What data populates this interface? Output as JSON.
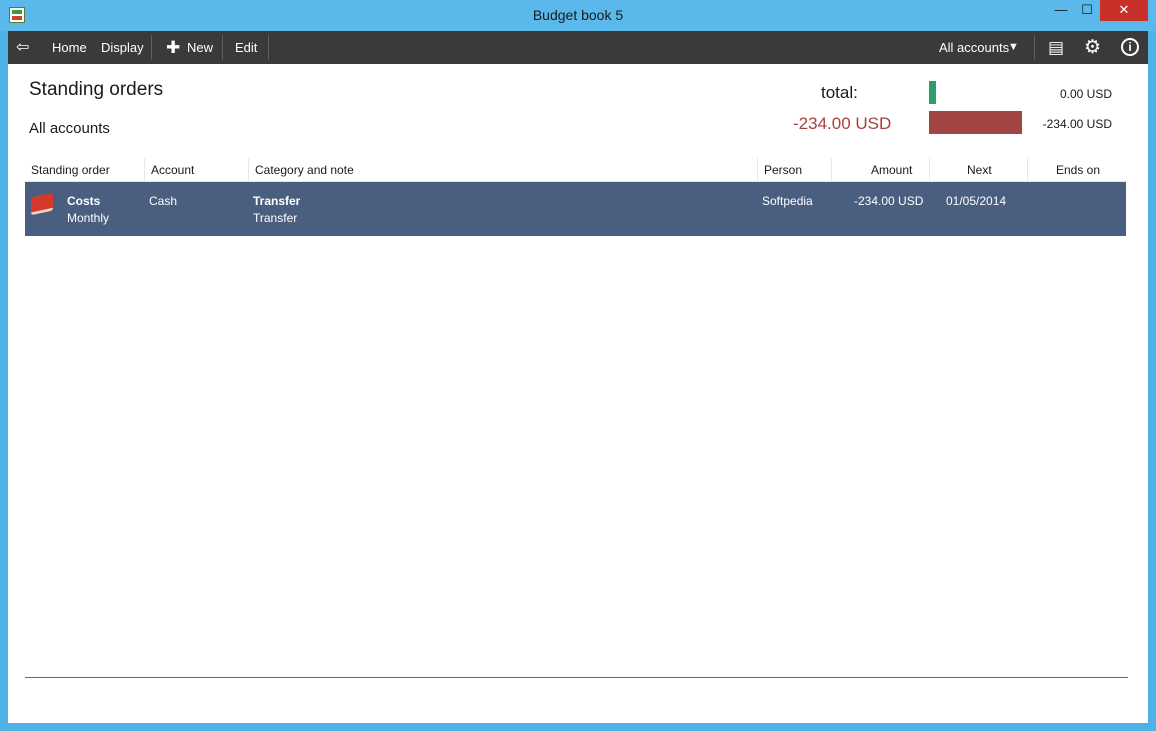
{
  "window": {
    "title": "Budget book 5",
    "minimize": "—",
    "maximize": "☐",
    "close": "✕"
  },
  "toolbar": {
    "back": "⇦",
    "home": "Home",
    "display": "Display",
    "new_plus": "✚",
    "new": "New",
    "edit": "Edit",
    "accounts": "All accounts",
    "caret": "▼",
    "book": "▤",
    "gear": "⚙",
    "info": "i"
  },
  "header": {
    "title": "Standing orders",
    "subtitle": "All accounts",
    "total_label": "total:",
    "negative_total": "-234.00 USD",
    "positive_value": "0.00 USD",
    "negative_value": "-234.00 USD"
  },
  "table": {
    "columns": [
      "Standing order",
      "Account",
      "Category and note",
      "Person",
      "Amount",
      "Next",
      "Ends on"
    ],
    "rows": [
      {
        "name": "Costs",
        "interval": "Monthly",
        "account": "Cash",
        "category": "Transfer",
        "note": "Transfer",
        "person": "Softpedia",
        "amount": "-234.00 USD",
        "next": "01/05/2014",
        "ends_on": ""
      }
    ]
  },
  "colors": {
    "positive_bar": "#2d9f6a",
    "negative_bar": "#a34545",
    "selected_row": "#4a5e80",
    "toolbar": "#3a3a3a"
  }
}
